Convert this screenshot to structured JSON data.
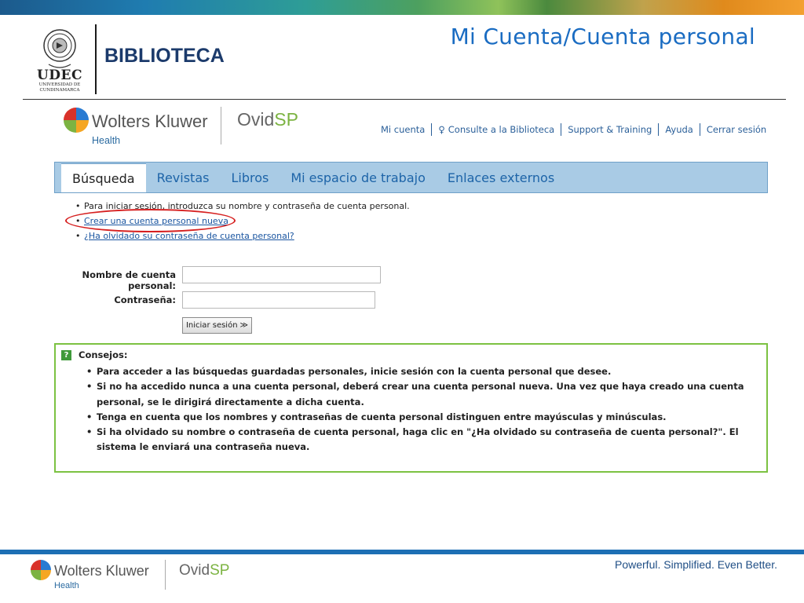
{
  "slide": {
    "title": "Mi Cuenta/Cuenta personal",
    "library_label": "BIBLIOTECA",
    "udec_name": "UDEC",
    "udec_sub1": "UNIVERSIDAD DE",
    "udec_sub2": "CUNDINAMARCA"
  },
  "brand": {
    "wk_name": "Wolters Kluwer",
    "wk_health": "Health",
    "ovid_a": "Ovid",
    "ovid_b": "SP",
    "ball_colors": [
      "#d9322a",
      "#2a7bd2",
      "#7cb342",
      "#f5a623"
    ]
  },
  "top_links": [
    "Mi cuenta",
    "Consulte a la Biblioteca",
    "Support & Training",
    "Ayuda",
    "Cerrar sesión"
  ],
  "nav": {
    "tabs": [
      "Búsqueda",
      "Revistas",
      "Libros",
      "Mi espacio de trabajo",
      "Enlaces externos"
    ],
    "active_index": 0
  },
  "intro": {
    "line1": "Para iniciar sesión, introduzca su nombre y contraseña de cuenta personal.",
    "create_link": "Crear una cuenta personal nueva",
    "forgot_link": "¿Ha olvidado su contraseña de cuenta personal?"
  },
  "form": {
    "name_label": "Nombre de cuenta personal:",
    "name_value": "",
    "password_label": "Contraseña:",
    "password_value": "",
    "login_button": "Iniciar sesión",
    "login_arrow": "≫"
  },
  "tips": {
    "icon": "?",
    "title": "Consejos:",
    "items": [
      "Para acceder a las búsquedas guardadas personales, inicie sesión con la cuenta personal que desee.",
      "Si no ha accedido nunca a una cuenta personal, deberá crear una cuenta personal nueva. Una vez que haya creado una cuenta personal, se le dirigirá directamente a dicha cuenta.",
      "Tenga en cuenta que los nombres y contraseñas de cuenta personal distinguen entre mayúsculas y minúsculas.",
      "Si ha olvidado su nombre o contraseña de cuenta personal, haga clic en \"¿Ha olvidado su contraseña de cuenta personal?\". El sistema le enviará una contraseña nueva."
    ]
  },
  "footer": {
    "tagline": "Powerful. Simplified. Even Better."
  },
  "colors": {
    "accent_blue": "#1a6cc2",
    "nav_bg": "#a9cbe5",
    "tips_border": "#7cc242",
    "highlight_red": "#d62020"
  }
}
